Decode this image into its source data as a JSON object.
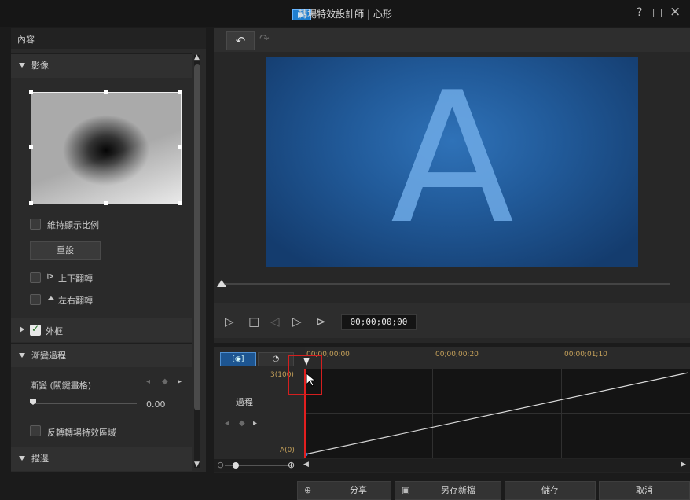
{
  "window": {
    "title": "轉場特效設計師 | 心形",
    "help": "?",
    "maximize": "□",
    "close": "×"
  },
  "left_panel": {
    "header": "內容",
    "image_section": {
      "title": "影像",
      "keep_ratio_label": "維持顯示比例",
      "reset_label": "重設",
      "flip_vertical_label": "上下翻轉",
      "flip_horizontal_label": "左右翻轉"
    },
    "frame_section": {
      "title": "外框",
      "checked": true
    },
    "transition_section": {
      "title": "漸變過程",
      "gradient_label": "漸變 (關鍵畫格)",
      "gradient_value": "0.00",
      "gradient_level": 0.0,
      "invert_label": "反轉轉場特效區域"
    },
    "stroke_section": {
      "title": "描邊"
    }
  },
  "preview": {
    "letter": "A",
    "timecode": "00;00;00;00"
  },
  "timeline": {
    "ruler_labels": [
      "00;00;00;00",
      "00;00;00;20",
      "00;00;01;10"
    ],
    "tab_a": "[◉]",
    "tab_b": "◔",
    "y_max_label": "3(100)",
    "y_min_label": "A(0)",
    "track_label": "過程"
  },
  "bottom": {
    "share": "分享",
    "save_as": "另存新檔",
    "save": "儲存",
    "cancel": "取消"
  },
  "colors": {
    "accent": "#1d5591",
    "playhead": "#e21f1f",
    "preview_blue": "#215a99"
  }
}
